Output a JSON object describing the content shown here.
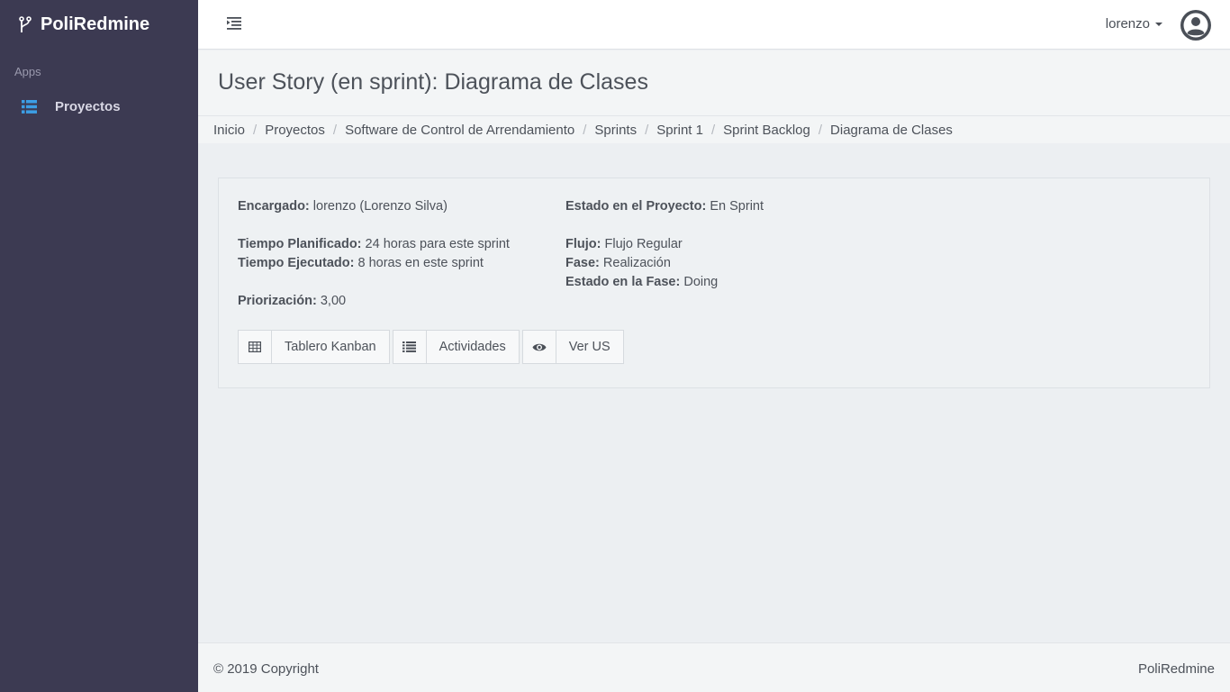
{
  "app": {
    "brand": "PoliRedmine",
    "brand_icon": "branch-icon"
  },
  "sidebar": {
    "section": "Apps",
    "items": [
      {
        "label": "Proyectos",
        "icon": "list-icon",
        "icon_color": "#3c9ee5"
      }
    ]
  },
  "topbar": {
    "toggle_icon": "sidebar-toggle-icon",
    "user": "lorenzo",
    "avatar_icon": "user-avatar-icon"
  },
  "page": {
    "title": "User Story (en sprint): Diagrama de Clases"
  },
  "breadcrumb": [
    "Inicio",
    "Proyectos",
    "Software de Control de Arrendamiento",
    "Sprints",
    "Sprint 1",
    "Sprint Backlog",
    "Diagrama de Clases"
  ],
  "details": {
    "encargado_label": "Encargado:",
    "encargado_value": "lorenzo (Lorenzo Silva)",
    "tiempo_planificado_label": "Tiempo Planificado:",
    "tiempo_planificado_value": "24 horas para este sprint",
    "tiempo_ejecutado_label": "Tiempo Ejecutado:",
    "tiempo_ejecutado_value": "8 horas en este sprint",
    "priorizacion_label": "Priorización:",
    "priorizacion_value": "3,00",
    "estado_proyecto_label": "Estado en el Proyecto:",
    "estado_proyecto_value": "En Sprint",
    "flujo_label": "Flujo:",
    "flujo_value": "Flujo Regular",
    "fase_label": "Fase:",
    "fase_value": "Realización",
    "estado_fase_label": "Estado en la Fase:",
    "estado_fase_value": "Doing"
  },
  "buttons": [
    {
      "label": "Tablero Kanban",
      "icon": "table-icon"
    },
    {
      "label": "Actividades",
      "icon": "list-icon"
    },
    {
      "label": "Ver US",
      "icon": "eye-icon"
    }
  ],
  "footer": {
    "copyright": "© 2019 Copyright",
    "brand": "PoliRedmine"
  }
}
